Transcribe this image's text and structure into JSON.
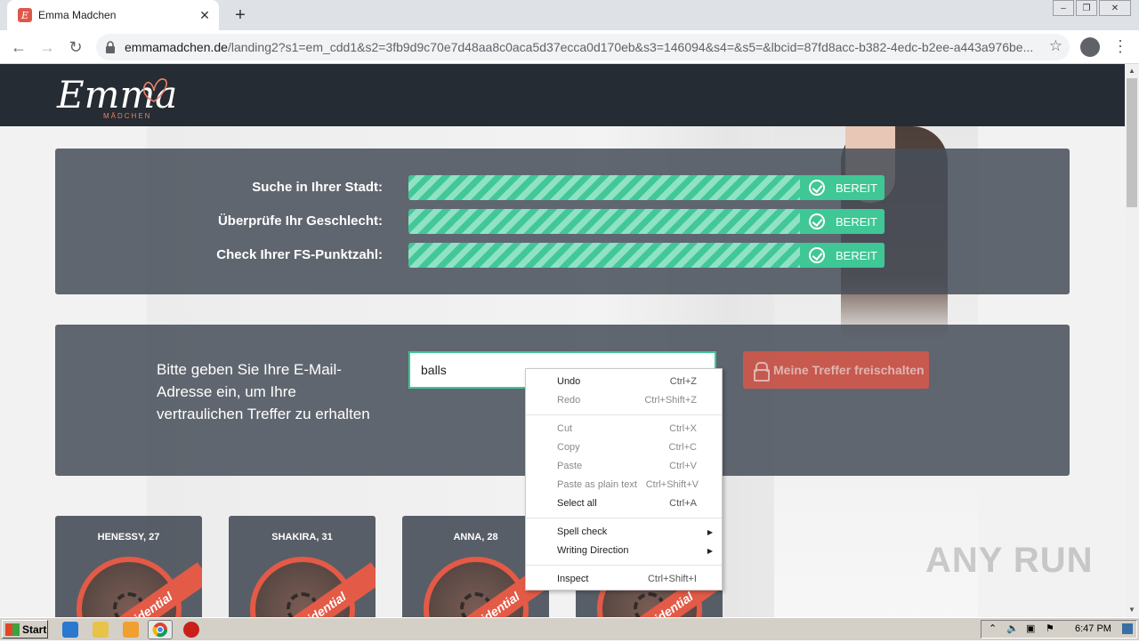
{
  "browser": {
    "tab_title": "Emma Madchen",
    "url_host": "emmamadchen.de",
    "url_path": "/landing2?s1=em_cdd1&s2=3fb9d9c70e7d48aa8c0aca5d37ecca0d170eb&s3=146094&s4=&s5=&lbcid=87fd8acc-b382-4edc-b2ee-a443a976be..."
  },
  "logo": {
    "text": "Emma",
    "sub": "MÄDCHEN"
  },
  "checks": [
    {
      "label": "Suche in Ihrer Stadt:",
      "status": "BEREIT"
    },
    {
      "label": "Überprüfe Ihr Geschlecht:",
      "status": "BEREIT"
    },
    {
      "label": "Check Ihrer FS-Punktzahl:",
      "status": "BEREIT"
    }
  ],
  "email": {
    "prompt": "Bitte geben Sie Ihre E-Mail-Adresse ein, um Ihre vertraulichen Treffer zu erhalten",
    "value": "balls",
    "button": "Meine Treffer freischalten"
  },
  "cards": [
    {
      "name": "HENESSY, 27",
      "ribbon": "idential"
    },
    {
      "name": "SHAKIRA, 31",
      "ribbon": "idential"
    },
    {
      "name": "ANNA, 28",
      "ribbon": "idential"
    },
    {
      "name": "",
      "ribbon": "idential"
    }
  ],
  "context_menu": [
    {
      "label": "Undo",
      "shortcut": "Ctrl+Z",
      "enabled": true
    },
    {
      "label": "Redo",
      "shortcut": "Ctrl+Shift+Z",
      "enabled": false
    },
    {
      "label": "Cut",
      "shortcut": "Ctrl+X",
      "enabled": false
    },
    {
      "label": "Copy",
      "shortcut": "Ctrl+C",
      "enabled": false
    },
    {
      "label": "Paste",
      "shortcut": "Ctrl+V",
      "enabled": false
    },
    {
      "label": "Paste as plain text",
      "shortcut": "Ctrl+Shift+V",
      "enabled": false
    },
    {
      "label": "Select all",
      "shortcut": "Ctrl+A",
      "enabled": true
    },
    {
      "label": "Spell check",
      "shortcut": "",
      "enabled": true
    },
    {
      "label": "Writing Direction",
      "shortcut": "",
      "enabled": true
    },
    {
      "label": "Inspect",
      "shortcut": "Ctrl+Shift+I",
      "enabled": true
    }
  ],
  "taskbar": {
    "start": "Start",
    "clock": "6:47 PM"
  },
  "watermark": "ANY RUN",
  "colors": {
    "header": "#252c33",
    "success": "#3fc796",
    "accent": "#e35a47"
  }
}
